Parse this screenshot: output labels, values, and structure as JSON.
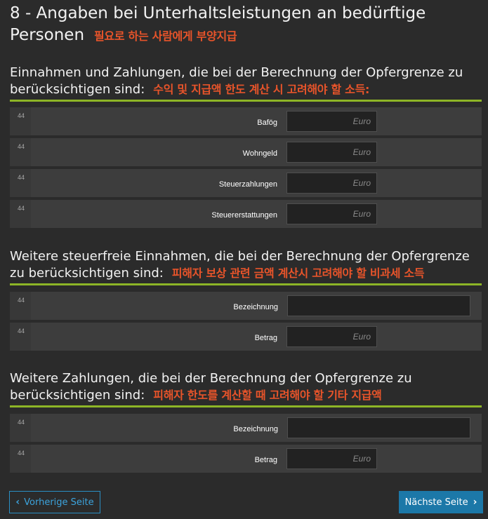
{
  "page": {
    "title": "8 - Angaben bei Unterhaltsleistungen an bedürftige Personen",
    "title_note": "필요로 하는 사람에게 부양지급"
  },
  "sections": [
    {
      "title": "Einnahmen und Zahlungen, die bei der Berechnung der Opfergrenze zu berücksichtigen sind:",
      "note": "수익 및 지급액 한도 계산 시 고려해야 할 소득:",
      "rows": [
        {
          "num": "44",
          "label": "Bafög",
          "placeholder": "Euro"
        },
        {
          "num": "44",
          "label": "Wohngeld",
          "placeholder": "Euro"
        },
        {
          "num": "44",
          "label": "Steuerzahlungen",
          "placeholder": "Euro"
        },
        {
          "num": "44",
          "label": "Steuererstattungen",
          "placeholder": "Euro"
        }
      ]
    },
    {
      "title": "Weitere steuerfreie Einnahmen, die bei der Berechnung der Opfergrenze zu berücksichtigen sind:",
      "note": "피해자 보상 관련 금액 계산시 고려해야 할 비과세 소득",
      "rows": [
        {
          "num": "44",
          "label": "Bezeichnung",
          "placeholder": ""
        },
        {
          "num": "44",
          "label": "Betrag",
          "placeholder": "Euro"
        }
      ]
    },
    {
      "title": "Weitere Zahlungen, die bei der Berechnung der Opfergrenze zu berücksichtigen sind:",
      "note": "피해자 한도를 계산할 때 고려해야 할 기타 지급액",
      "rows": [
        {
          "num": "44",
          "label": "Bezeichnung",
          "placeholder": ""
        },
        {
          "num": "44",
          "label": "Betrag",
          "placeholder": "Euro"
        }
      ]
    }
  ],
  "nav": {
    "prev_label": "Vorherige Seite",
    "next_label": "Nächste Seite",
    "prev_icon": "chevron-left-icon",
    "next_icon": "chevron-right-icon"
  },
  "colors": {
    "accent_line": "#8db526",
    "note": "#e8542a",
    "primary_button": "#1c78a8"
  }
}
